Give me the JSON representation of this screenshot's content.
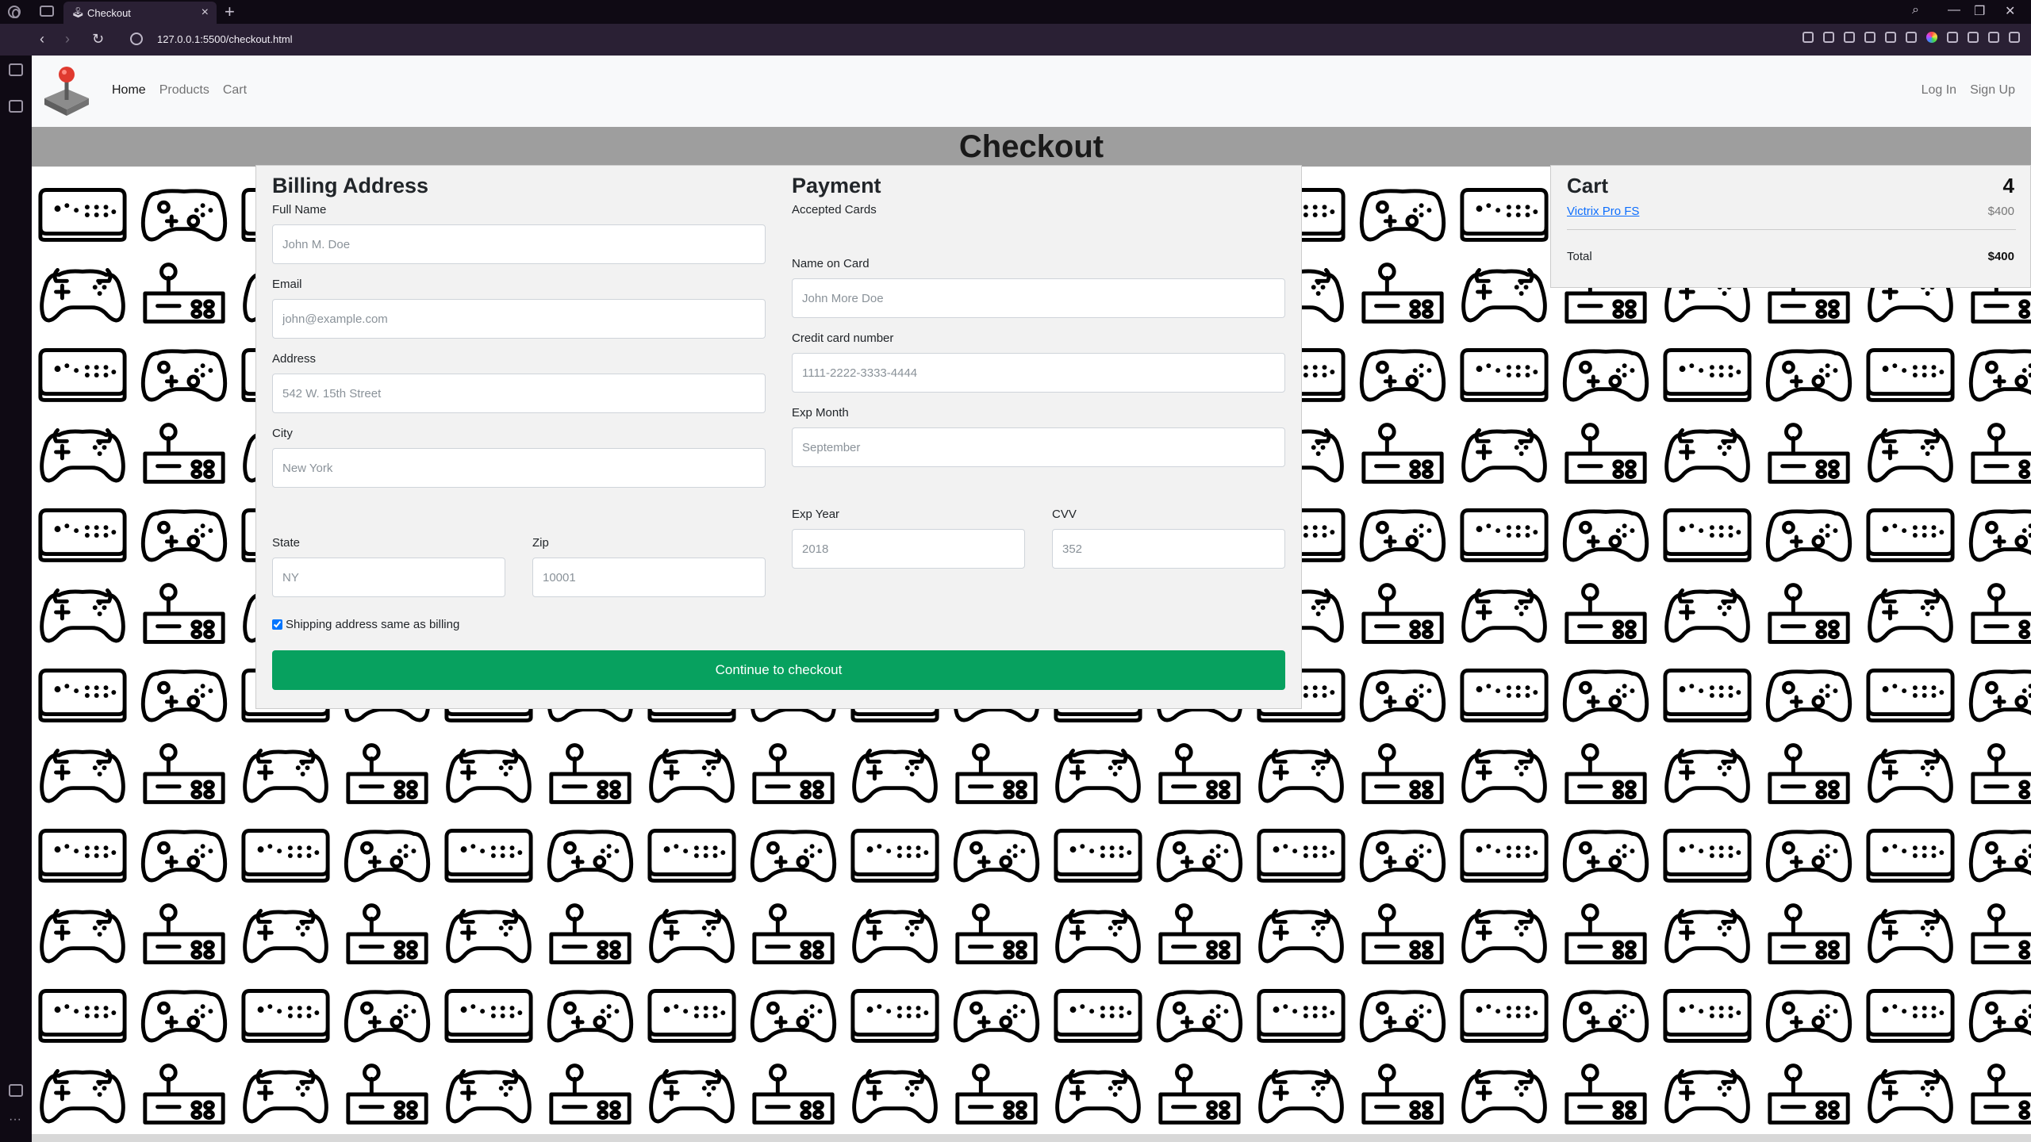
{
  "browser": {
    "tab_title": "Checkout",
    "url": "127.0.0.1:5500/checkout.html",
    "icons": [
      "browser-logo-icon",
      "tab-list-icon",
      "page-favicon-icon",
      "close-icon",
      "plus-icon",
      "search-icon",
      "minimize-icon",
      "restore-icon",
      "close-window-icon",
      "back-icon",
      "forward-icon",
      "reload-icon",
      "site-info-icon",
      "share-icon",
      "camera-icon",
      "shield-icon",
      "send-icon",
      "heart-icon",
      "sidebar-icon",
      "wallet-icon",
      "box-icon",
      "download-icon",
      "menu-icon",
      "extensions-icon"
    ]
  },
  "navbar": {
    "links": [
      {
        "label": "Home"
      },
      {
        "label": "Products"
      },
      {
        "label": "Cart"
      }
    ],
    "auth": [
      {
        "label": "Log In"
      },
      {
        "label": "Sign Up"
      }
    ]
  },
  "page": {
    "title": "Checkout"
  },
  "billing": {
    "heading": "Billing Address",
    "full_name": {
      "label": "Full Name",
      "placeholder": "John M. Doe"
    },
    "email": {
      "label": "Email",
      "placeholder": "john@example.com"
    },
    "address": {
      "label": "Address",
      "placeholder": "542 W. 15th Street"
    },
    "city": {
      "label": "City",
      "placeholder": "New York"
    },
    "state": {
      "label": "State",
      "placeholder": "NY"
    },
    "zip": {
      "label": "Zip",
      "placeholder": "10001"
    },
    "shipping_same": {
      "label": "Shipping address same as billing",
      "checked": true
    }
  },
  "payment": {
    "heading": "Payment",
    "accepted_cards_label": "Accepted Cards",
    "name_on_card": {
      "label": "Name on Card",
      "placeholder": "John More Doe"
    },
    "card_number": {
      "label": "Credit card number",
      "placeholder": "1111-2222-3333-4444"
    },
    "exp_month": {
      "label": "Exp Month",
      "placeholder": "September"
    },
    "exp_year": {
      "label": "Exp Year",
      "placeholder": "2018"
    },
    "cvv": {
      "label": "CVV",
      "placeholder": "352"
    }
  },
  "continue_button": "Continue to checkout",
  "cart": {
    "title": "Cart",
    "count": "4",
    "items": [
      {
        "name": "Victrix Pro FS",
        "price": "$400"
      }
    ],
    "total_label": "Total",
    "total_value": "$400"
  },
  "colors": {
    "primary_button": "#07a15f",
    "title_bar": "#9e9e9e",
    "link": "#0d6efd"
  }
}
